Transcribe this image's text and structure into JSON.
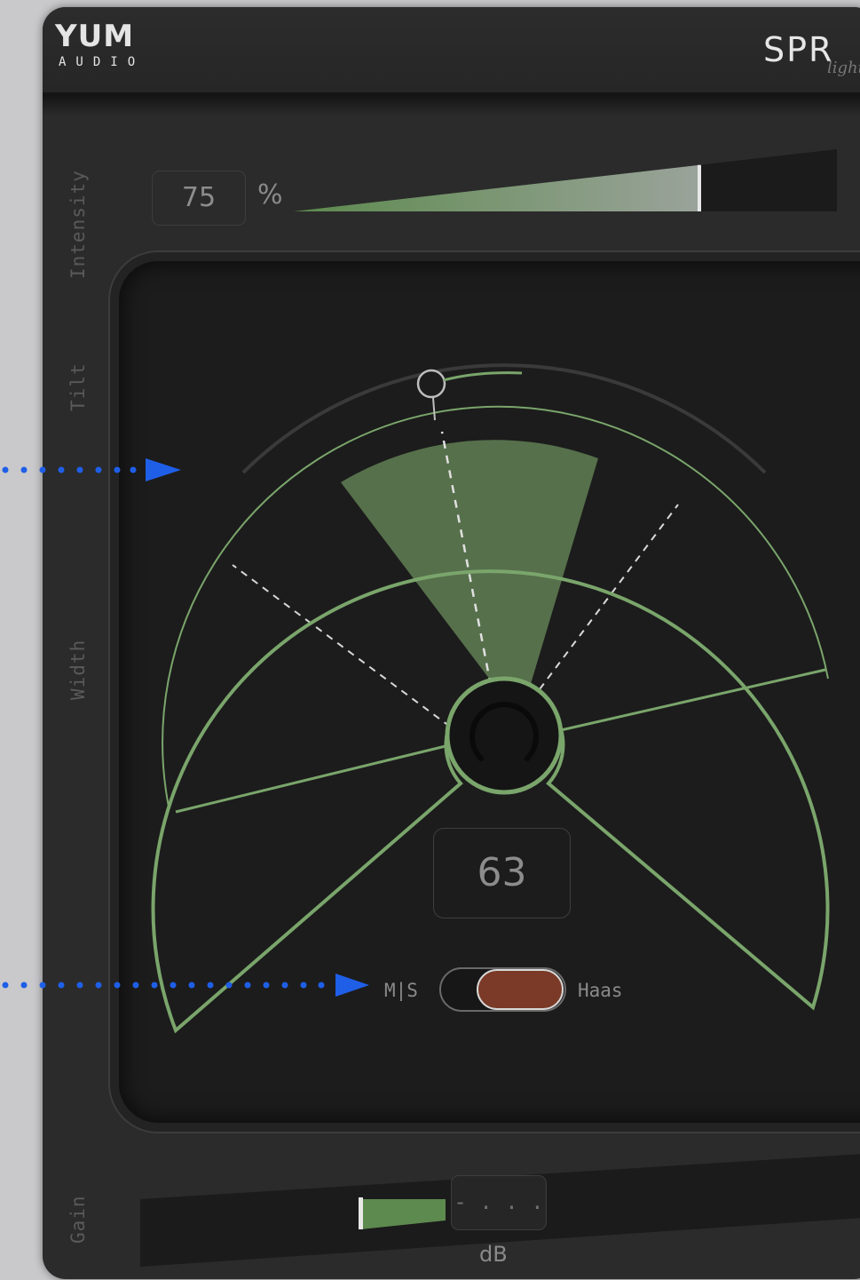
{
  "header": {
    "brand_name": "YUM",
    "brand_sub": "AUDIO",
    "product_name": "SPR",
    "product_sub": "light"
  },
  "side_labels": {
    "intensity": "Intensity",
    "tilt": "Tilt",
    "width": "Width",
    "gain": "Gain"
  },
  "intensity": {
    "value": "75",
    "unit": "%",
    "fill_fraction": 0.75
  },
  "width": {
    "value": "63"
  },
  "mode_toggle": {
    "left_label": "M|S",
    "right_label": "Haas",
    "selected": "Haas"
  },
  "gain": {
    "value": "- . . .",
    "unit": "dB"
  },
  "colors": {
    "accent_green": "#7aa56b",
    "sector_fill": "#56704b",
    "panel_bg": "#2b2b2b",
    "display_bg": "#1c1c1c",
    "toggle_knob": "#7a3a27",
    "annotation_arrow": "#1f5fe8"
  },
  "icons": {
    "width_knob": "knob-arc-icon",
    "tilt_handle": "tilt-handle-icon"
  }
}
